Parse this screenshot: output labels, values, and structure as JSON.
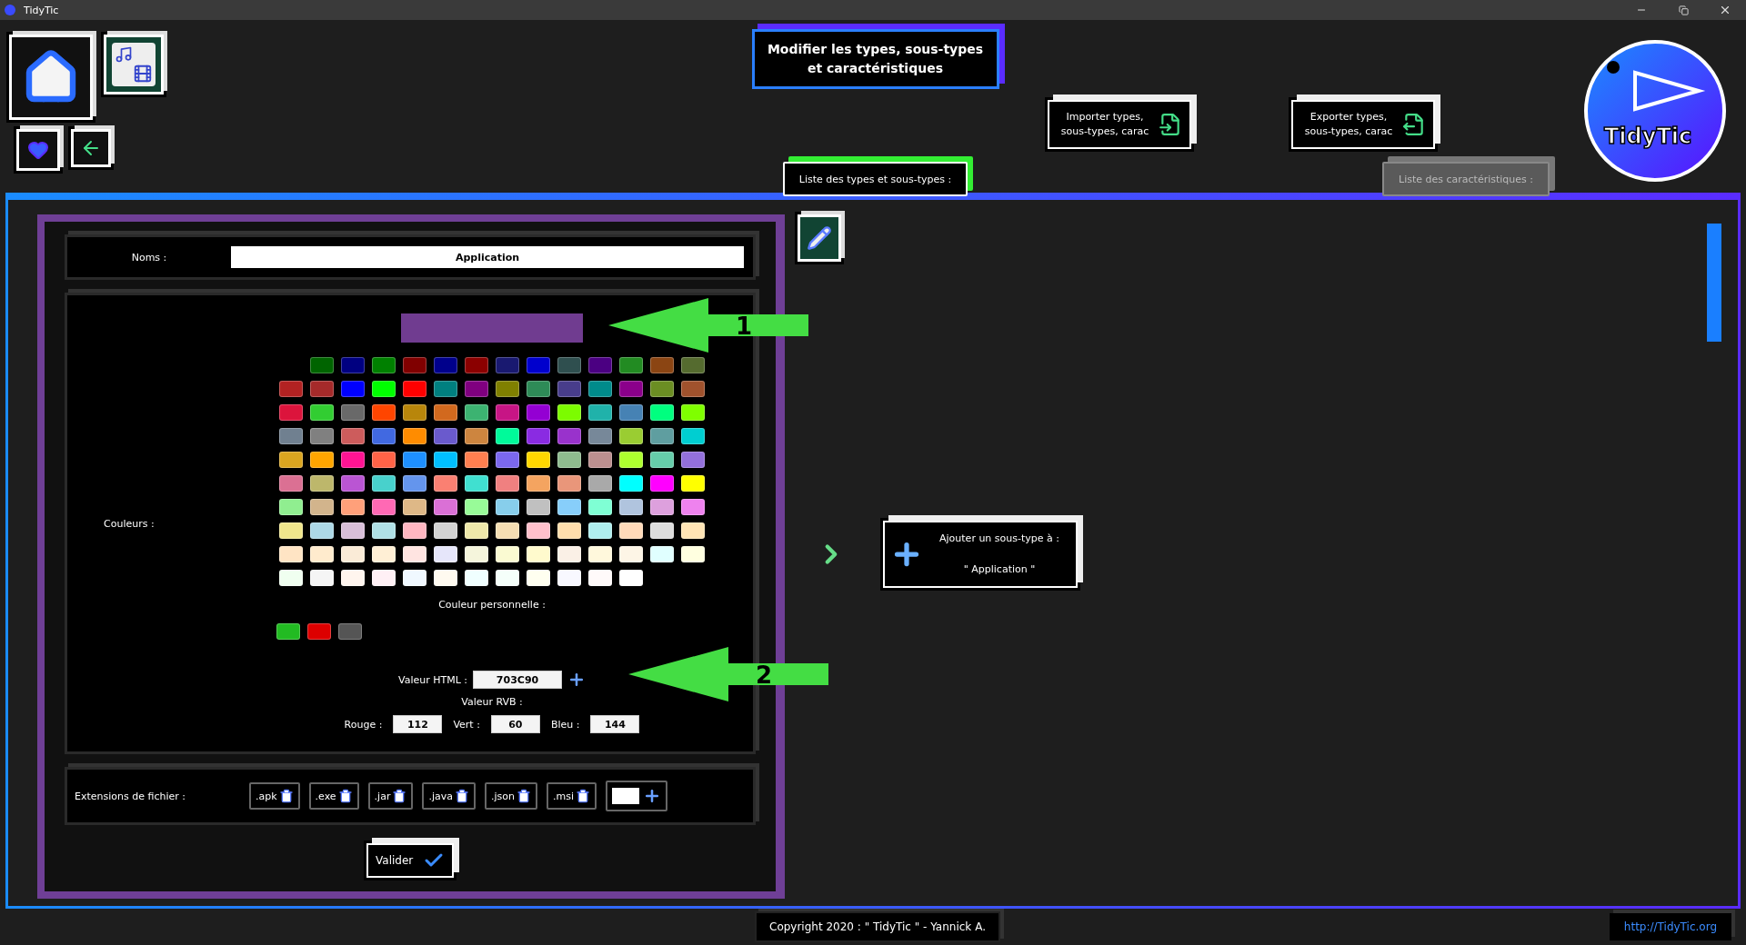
{
  "window": {
    "title": "TidyTic"
  },
  "header": {
    "title": "Modifier les types, sous-types et caractéristiques",
    "import_button": "Importer types, sous-types, carac",
    "export_button": "Exporter types, sous-types, carac",
    "logo_text": "TidyTic"
  },
  "tabs": [
    {
      "label": "Liste des types et sous-types :",
      "selected": true
    },
    {
      "label": "Liste des caractéristiques :",
      "selected": false
    }
  ],
  "form": {
    "name_label": "Noms :",
    "name_value": "Application",
    "colors_label": "Couleurs :",
    "preview": {
      "color": "#703c90",
      "annotation": "1"
    },
    "palette": [
      {
        "kind": "offset",
        "swatches": [
          {
            "color": "#006400"
          },
          {
            "color": "#000080"
          },
          {
            "color": "#008000"
          },
          {
            "color": "#800000"
          },
          {
            "color": "#00008b"
          },
          {
            "color": "#8b0000"
          },
          {
            "color": "#191970"
          },
          {
            "color": "#0000cd"
          },
          {
            "color": "#2f4f4f"
          },
          {
            "color": "#4b0082"
          },
          {
            "color": "#228b22"
          },
          {
            "color": "#8b4513"
          },
          {
            "color": "#556b2f"
          }
        ]
      },
      {
        "kind": "full",
        "swatches": [
          {
            "color": "#b22222"
          },
          {
            "color": "#a52a2a"
          },
          {
            "color": "#0000ff"
          },
          {
            "color": "#00ff00"
          },
          {
            "color": "#ff0000"
          },
          {
            "color": "#008080"
          },
          {
            "color": "#800080"
          },
          {
            "color": "#808000"
          },
          {
            "color": "#2e8b57"
          },
          {
            "color": "#483d8b"
          },
          {
            "color": "#008b8b"
          },
          {
            "color": "#8b008b"
          },
          {
            "color": "#6b8e23"
          },
          {
            "color": "#a0522d"
          }
        ]
      },
      {
        "kind": "full",
        "swatches": [
          {
            "color": "#dc143c"
          },
          {
            "color": "#32cd32"
          },
          {
            "color": "#696969"
          },
          {
            "color": "#ff4500"
          },
          {
            "color": "#b8860b"
          },
          {
            "color": "#d2691e"
          },
          {
            "color": "#3cb371"
          },
          {
            "color": "#c71585"
          },
          {
            "color": "#9400d3"
          },
          {
            "color": "#7cfc00"
          },
          {
            "color": "#20b2aa"
          },
          {
            "color": "#4682b4"
          },
          {
            "color": "#00ff7f"
          },
          {
            "color": "#7fff00"
          }
        ]
      },
      {
        "kind": "full",
        "swatches": [
          {
            "color": "#708090"
          },
          {
            "color": "#808080"
          },
          {
            "color": "#cd5c5c"
          },
          {
            "color": "#4169e1"
          },
          {
            "color": "#ff8c00"
          },
          {
            "color": "#6a5acd"
          },
          {
            "color": "#cd853f"
          },
          {
            "color": "#00fa9a"
          },
          {
            "color": "#8a2be2"
          },
          {
            "color": "#9932cc"
          },
          {
            "color": "#778899"
          },
          {
            "color": "#9acd32"
          },
          {
            "color": "#5f9ea0"
          },
          {
            "color": "#00ced1"
          }
        ]
      },
      {
        "kind": "full",
        "swatches": [
          {
            "color": "#daa520"
          },
          {
            "color": "#ffa500"
          },
          {
            "color": "#ff1493"
          },
          {
            "color": "#ff6347"
          },
          {
            "color": "#1e90ff"
          },
          {
            "color": "#00bfff"
          },
          {
            "color": "#ff7f50"
          },
          {
            "color": "#7b68ee"
          },
          {
            "color": "#ffd700"
          },
          {
            "color": "#8fbc8f"
          },
          {
            "color": "#bc8f8f"
          },
          {
            "color": "#adff2f"
          },
          {
            "color": "#66cdaa"
          },
          {
            "color": "#9370db"
          }
        ]
      },
      {
        "kind": "full",
        "swatches": [
          {
            "color": "#db7093"
          },
          {
            "color": "#bdb76b"
          },
          {
            "color": "#ba55d3"
          },
          {
            "color": "#48d1cc"
          },
          {
            "color": "#6495ed"
          },
          {
            "color": "#fa8072"
          },
          {
            "color": "#40e0d0"
          },
          {
            "color": "#f08080"
          },
          {
            "color": "#f4a460"
          },
          {
            "color": "#e9967a"
          },
          {
            "color": "#a9a9a9"
          },
          {
            "color": "#00ffff"
          },
          {
            "color": "#ff00ff"
          },
          {
            "color": "#ffff00"
          }
        ]
      },
      {
        "kind": "full",
        "swatches": [
          {
            "color": "#90ee90"
          },
          {
            "color": "#d2b48c"
          },
          {
            "color": "#ffa07a"
          },
          {
            "color": "#ff69b4"
          },
          {
            "color": "#deb887"
          },
          {
            "color": "#da70d6"
          },
          {
            "color": "#98fb98"
          },
          {
            "color": "#87ceeb"
          },
          {
            "color": "#c0c0c0"
          },
          {
            "color": "#87cefa"
          },
          {
            "color": "#7fffd4"
          },
          {
            "color": "#b0c4de"
          },
          {
            "color": "#dda0dd"
          },
          {
            "color": "#ee82ee"
          }
        ]
      },
      {
        "kind": "full",
        "swatches": [
          {
            "color": "#f0e68c"
          },
          {
            "color": "#add8e6"
          },
          {
            "color": "#d8bfd8"
          },
          {
            "color": "#b0e0e6"
          },
          {
            "color": "#ffb6c1"
          },
          {
            "color": "#d3d3d3"
          },
          {
            "color": "#eee8aa"
          },
          {
            "color": "#f5deb3"
          },
          {
            "color": "#ffc0cb"
          },
          {
            "color": "#ffdead"
          },
          {
            "color": "#afeeee"
          },
          {
            "color": "#ffdab9"
          },
          {
            "color": "#dcdcdc"
          },
          {
            "color": "#ffe4b5"
          }
        ]
      },
      {
        "kind": "full",
        "swatches": [
          {
            "color": "#ffe4c4"
          },
          {
            "color": "#ffebcd"
          },
          {
            "color": "#faebd7"
          },
          {
            "color": "#ffefd5"
          },
          {
            "color": "#ffe4e1"
          },
          {
            "color": "#e6e6fa"
          },
          {
            "color": "#f5f5dc"
          },
          {
            "color": "#fafad2"
          },
          {
            "color": "#fffacd"
          },
          {
            "color": "#faf0e6"
          },
          {
            "color": "#fff8dc"
          },
          {
            "color": "#fdf5e6"
          },
          {
            "color": "#e0ffff"
          },
          {
            "color": "#ffffe0"
          }
        ]
      },
      {
        "kind": "full",
        "swatches": [
          {
            "color": "#f0fff0"
          },
          {
            "color": "#f5f5f5"
          },
          {
            "color": "#fff5ee"
          },
          {
            "color": "#fff0f5"
          },
          {
            "color": "#f0f8ff"
          },
          {
            "color": "#fffaf0"
          },
          {
            "color": "#f0ffff"
          },
          {
            "color": "#f5fffa"
          },
          {
            "color": "#fffff0"
          },
          {
            "color": "#f8f8ff"
          },
          {
            "color": "#fffafa"
          },
          {
            "color": "#ffffff"
          }
        ]
      }
    ],
    "custom_label": "Couleur personnelle :",
    "custom_colors": [
      {
        "color": "#22bb22"
      },
      {
        "color": "#dd0000"
      },
      {
        "color": "#555555"
      }
    ],
    "html": {
      "label": "Valeur HTML :",
      "value": "703C90",
      "annotation": "2"
    },
    "rgb_label": "Valeur RVB :",
    "rgb": [
      {
        "label": "Rouge :",
        "value": "112"
      },
      {
        "label": "Vert :",
        "value": "60"
      },
      {
        "label": "Bleu :",
        "value": "144"
      }
    ],
    "extensions_label": "Extensions de fichier :",
    "extensions": [
      ".apk",
      ".exe",
      ".jar",
      ".java",
      ".json",
      ".msi"
    ],
    "validate_button": "Valider"
  },
  "add_subtype": {
    "line1": "Ajouter un sous-type à :",
    "line2": "\" Application \""
  },
  "footer": {
    "copyright": "Copyright 2020 : \" TidyTic \" - Yannick A.",
    "link": "http://TidyTic.org"
  }
}
